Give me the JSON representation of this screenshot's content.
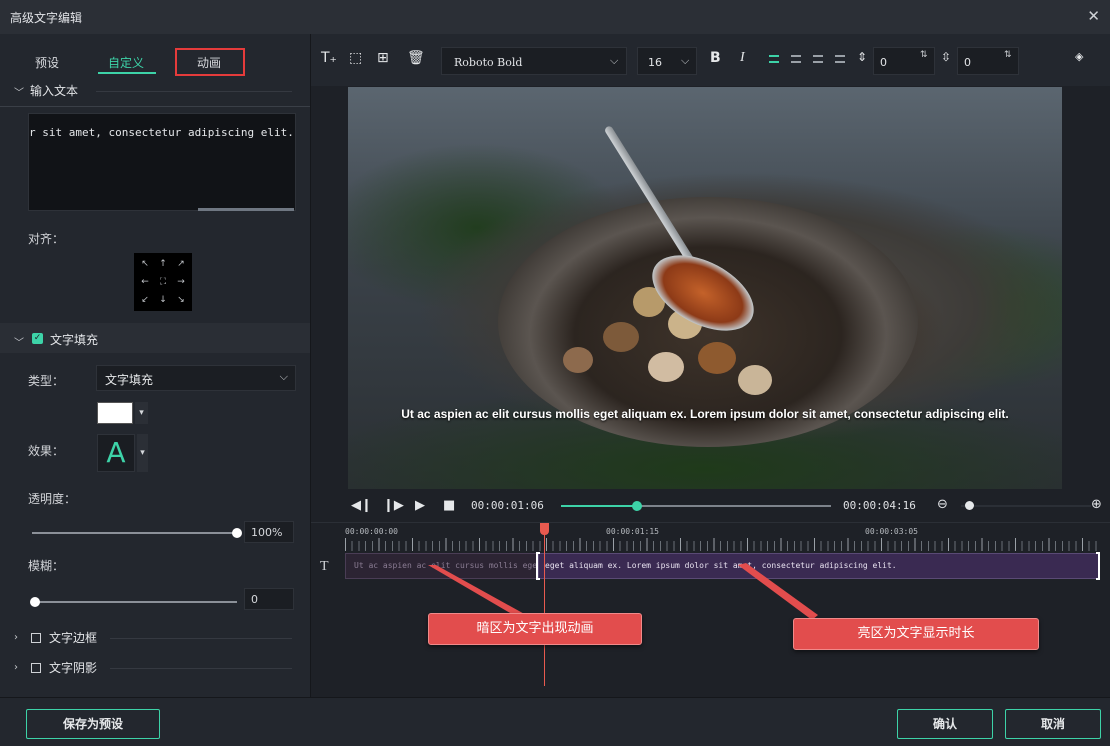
{
  "window": {
    "title": "高级文字编辑",
    "close_icon": "close-icon"
  },
  "tabs": [
    {
      "label": "预设",
      "active": false
    },
    {
      "label": "自定义",
      "active": true
    },
    {
      "label": "动画",
      "active": false,
      "highlighted": true
    }
  ],
  "input_section": {
    "title": "输入文本",
    "text_value": "r sit amet, consectetur adipiscing elit."
  },
  "align": {
    "label": "对齐：",
    "grid": [
      "↖",
      "↑",
      "↗",
      "←",
      "⛶",
      "→",
      "↙",
      "↓",
      "↘"
    ]
  },
  "fill_section": {
    "title": "文字填充",
    "checked": true,
    "type_label": "类型：",
    "type_value": "文字填充",
    "color": "#ffffff",
    "effect_label": "效果：",
    "effect_glyph": "A",
    "effect_color": "#3dd3a8",
    "opacity_label": "透明度：",
    "opacity_value": "100%",
    "opacity_level": 1.0,
    "blur_label": "模糊：",
    "blur_value": "0",
    "blur_level": 0.0
  },
  "border_section": {
    "title": "文字边框",
    "checked": false
  },
  "shadow_section": {
    "title": "文字阴影",
    "checked": false
  },
  "toolbar": {
    "font_name": "Roboto Bold",
    "font_size": "16",
    "bold": "B",
    "italic": "I",
    "char_spacing": "0",
    "line_spacing": "0",
    "tools": [
      "add-text-icon",
      "text-box-icon",
      "add-image-icon",
      "delete-icon"
    ]
  },
  "preview": {
    "caption": "Ut ac aspien ac elit cursus mollis eget aliquam ex. Lorem ipsum dolor sit amet, consectetur adipiscing elit."
  },
  "playback": {
    "current_time": "00:00:01:06",
    "duration": "00:00:04:16",
    "progress": 0.28
  },
  "timeline": {
    "ruler": [
      "00:00:00:00",
      "00:00:01:15",
      "00:00:03:05"
    ],
    "track_icon": "T",
    "clip_text": "Ut ac aspien ac elit cursus mollis eget aliquam ex. Lorem ipsum dolor sit amet, consectetur adipiscing elit.",
    "clip_text_light": "eget aliquam ex. Lorem ipsum dolor sit amet, consectetur adipiscing elit."
  },
  "annotations": {
    "dark_area": "暗区为文字出现动画",
    "light_area": "亮区为文字显示时长"
  },
  "buttons": {
    "save_preset": "保存为预设",
    "confirm": "确认",
    "cancel": "取消"
  },
  "colors": {
    "accent": "#3dd3a8",
    "highlight": "#e53b3b",
    "callout": "#e24d4d"
  }
}
